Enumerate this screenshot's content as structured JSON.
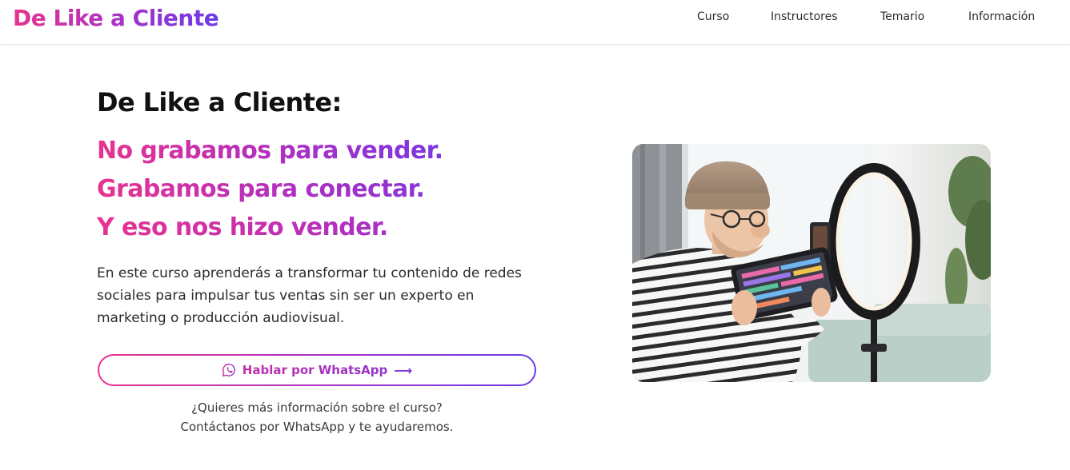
{
  "nav": {
    "brand": "De Like a Cliente",
    "links": [
      "Curso",
      "Instructores",
      "Temario",
      "Información"
    ]
  },
  "hero": {
    "title": "De Like a Cliente:",
    "taglines": [
      "No grabamos para vender.",
      "Grabamos para conectar.",
      "Y eso nos hizo vender."
    ],
    "description": "En este curso aprenderás a transformar tu contenido de redes sociales para impulsar tus ventas sin ser un experto en marketing o producción audiovisual.",
    "cta": {
      "label": "Hablar por WhatsApp",
      "arrow": "⟶",
      "icon": "whatsapp-icon"
    },
    "help_lines": [
      "¿Quieres más información sobre el curso?",
      "Contáctanos por WhatsApp y te ayudaremos."
    ],
    "image": {
      "subject": "content-creator-with-tablet-and-ring-light"
    }
  },
  "colors": {
    "gradient_start": "#e8338f",
    "gradient_mid": "#a532c8",
    "gradient_end": "#6b3be8",
    "text_dark": "#111111"
  }
}
